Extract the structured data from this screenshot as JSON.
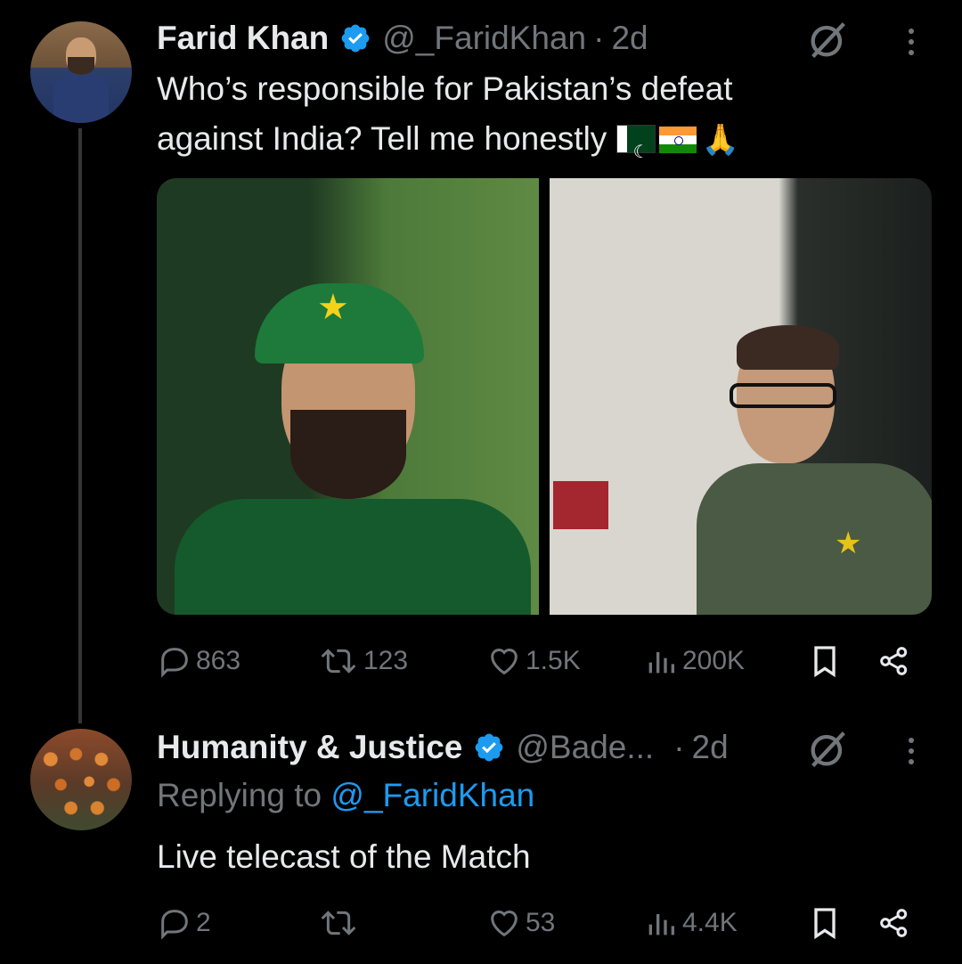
{
  "tweets": [
    {
      "author": "Farid Khan",
      "handle": "@_FaridKhan",
      "time": "2d",
      "text_line1": "Who’s responsible for Pakistan’s defeat",
      "text_line2": "against India? Tell me honestly",
      "flags": [
        "pakistan-flag",
        "india-flag",
        "folded-hands"
      ],
      "stats": {
        "replies": "863",
        "reposts": "123",
        "likes": "1.5K",
        "views": "200K"
      }
    },
    {
      "author": "Humanity & Justice",
      "handle": "@Bade...",
      "time": "2d",
      "replying_prefix": "Replying to",
      "replying_to": "@_FaridKhan",
      "text": "Live telecast of the Match",
      "stats": {
        "replies": "2",
        "reposts": "",
        "likes": "53",
        "views": "4.4K"
      }
    }
  ],
  "colors": {
    "background": "#000000",
    "text": "#e7e9ea",
    "muted": "#71767b",
    "link": "#1d9bf0",
    "verified": "#1d9bf0"
  }
}
